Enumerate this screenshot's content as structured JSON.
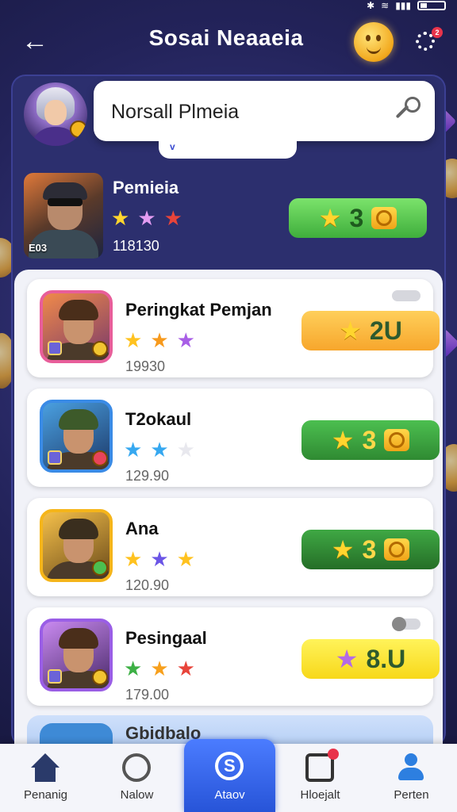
{
  "header": {
    "title": "Sosai Neaaeia",
    "back_label": "←",
    "notification_count": "2"
  },
  "search": {
    "value": "Norsall Plmeia",
    "dropdown_label": "v"
  },
  "featured": {
    "name": "Pemieia",
    "level_badge": "E03",
    "score": "118130",
    "stars": [
      "#ffd52e",
      "#e39cf2",
      "#e8443a"
    ],
    "reward_value": "3"
  },
  "cards": [
    {
      "name": "Peringkat Pemjan",
      "score": "19930",
      "stars": [
        "#ffc21f",
        "#f79a1d",
        "#a85ee6"
      ],
      "reward_value": "2U",
      "reward_color": "#ffbf3d",
      "reward_text_color": "#2e5a2e",
      "avatar_border": "#e85e9a",
      "toggle": "off"
    },
    {
      "name": "T2okaul",
      "score": "129.90",
      "stars": [
        "#36a8f0",
        "#36a8f0",
        "#e8e8ee"
      ],
      "reward_value": "3",
      "reward_color": "#3fa844",
      "reward_text_color": "#ffd84a",
      "avatar_border": "#3a8be6",
      "toggle": "none"
    },
    {
      "name": "Ana",
      "score": "120.90",
      "stars": [
        "#ffc21f",
        "#6b55e6",
        "#ffc21f"
      ],
      "reward_value": "3",
      "reward_color": "#2f8a32",
      "reward_text_color": "#ffd84a",
      "avatar_border": "#f5b51a",
      "toggle": "none"
    },
    {
      "name": "Pesingaal",
      "score": "179.00",
      "stars": [
        "#3db045",
        "#f7a01d",
        "#e8443a"
      ],
      "reward_value": "8.U",
      "reward_color": "#fde82e",
      "reward_text_color": "#2e5a2e",
      "avatar_border": "#9a5ee6",
      "toggle": "on"
    }
  ],
  "partial_card": {
    "name": "Gbidbalo"
  },
  "bottom_nav": [
    {
      "label": "Penanig",
      "icon": "home-icon"
    },
    {
      "label": "Nalow",
      "icon": "gauge-icon"
    },
    {
      "label": "Ataov",
      "icon": "social-s-icon",
      "active": true
    },
    {
      "label": "Hloejalt",
      "icon": "inbox-icon"
    },
    {
      "label": "Perten",
      "icon": "profile-icon"
    }
  ]
}
